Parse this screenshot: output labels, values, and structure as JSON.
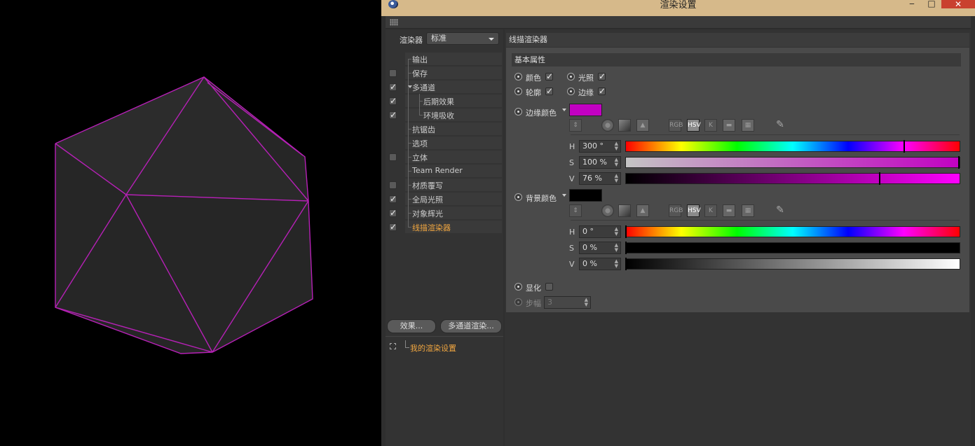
{
  "window": {
    "title": "渲染设置",
    "min_glyph": "‒",
    "max_glyph": "□",
    "close_glyph": "✕"
  },
  "renderer": {
    "label": "渲染器",
    "value": "标准"
  },
  "tree": [
    {
      "label": "输出",
      "checkbox": false,
      "checked": false,
      "depth": 0,
      "selected": false
    },
    {
      "label": "保存",
      "checkbox": true,
      "checked": false,
      "depth": 0,
      "selected": false
    },
    {
      "label": "多通道",
      "checkbox": true,
      "checked": true,
      "depth": 0,
      "selected": false,
      "expanded": true
    },
    {
      "label": "后期效果",
      "checkbox": true,
      "checked": true,
      "depth": 1,
      "selected": false
    },
    {
      "label": "环境吸收",
      "checkbox": true,
      "checked": true,
      "depth": 1,
      "selected": false
    },
    {
      "label": "抗锯齿",
      "checkbox": false,
      "checked": false,
      "depth": 0,
      "selected": false
    },
    {
      "label": "选项",
      "checkbox": false,
      "checked": false,
      "depth": 0,
      "selected": false
    },
    {
      "label": "立体",
      "checkbox": true,
      "checked": false,
      "depth": 0,
      "selected": false
    },
    {
      "label": "Team Render",
      "checkbox": false,
      "checked": false,
      "depth": 0,
      "selected": false
    },
    {
      "label": "材质覆写",
      "checkbox": true,
      "checked": false,
      "depth": 0,
      "selected": false
    },
    {
      "label": "全局光照",
      "checkbox": true,
      "checked": true,
      "depth": 0,
      "selected": false
    },
    {
      "label": "对象辉光",
      "checkbox": true,
      "checked": true,
      "depth": 0,
      "selected": false
    },
    {
      "label": "线描渲染器",
      "checkbox": true,
      "checked": true,
      "depth": 0,
      "selected": true
    }
  ],
  "checkmark_glyph": "✓",
  "buttons": {
    "effects": "效果...",
    "multipass": "多通道渲染..."
  },
  "settings_item": "我的渲染设置",
  "section_title": "线描渲染器",
  "basic_header": "基本属性",
  "options": {
    "color": {
      "label": "颜色",
      "checked": true
    },
    "illumination": {
      "label": "光照",
      "checked": true
    },
    "outline": {
      "label": "轮廓",
      "checked": true
    },
    "edges": {
      "label": "边缘",
      "checked": true
    }
  },
  "edge_color": {
    "label": "边缘颜色",
    "hex": "#c200c2",
    "mode_buttons": [
      "RGB",
      "HSV",
      "K"
    ],
    "active_mode": "HSV",
    "H": {
      "label": "H",
      "value": "300 °",
      "fraction": 0.833
    },
    "S": {
      "label": "S",
      "value": "100 %",
      "fraction": 1.0
    },
    "V": {
      "label": "V",
      "value": "76 %",
      "fraction": 0.76
    },
    "s_gradient": [
      "#c4c4c4",
      "#c200c2"
    ],
    "v_gradient": [
      "#000000",
      "#ff00ff"
    ]
  },
  "bg_color": {
    "label": "背景颜色",
    "hex": "#000000",
    "mode_buttons": [
      "RGB",
      "HSV",
      "K"
    ],
    "active_mode": "HSV",
    "H": {
      "label": "H",
      "value": "0 °",
      "fraction": 0.0
    },
    "S": {
      "label": "S",
      "value": "0 %",
      "fraction": 0.0
    },
    "V": {
      "label": "V",
      "value": "0 %",
      "fraction": 0.0
    },
    "s_gradient": [
      "#000000",
      "#000000"
    ],
    "v_gradient": [
      "#000000",
      "#ffffff"
    ]
  },
  "opacity": {
    "label": "显化",
    "checked": false
  },
  "steps": {
    "label": "步幅",
    "value": "3"
  },
  "colors": {
    "wireframe": "#b620b6",
    "face": "#262626",
    "accent": "#f0a640"
  }
}
